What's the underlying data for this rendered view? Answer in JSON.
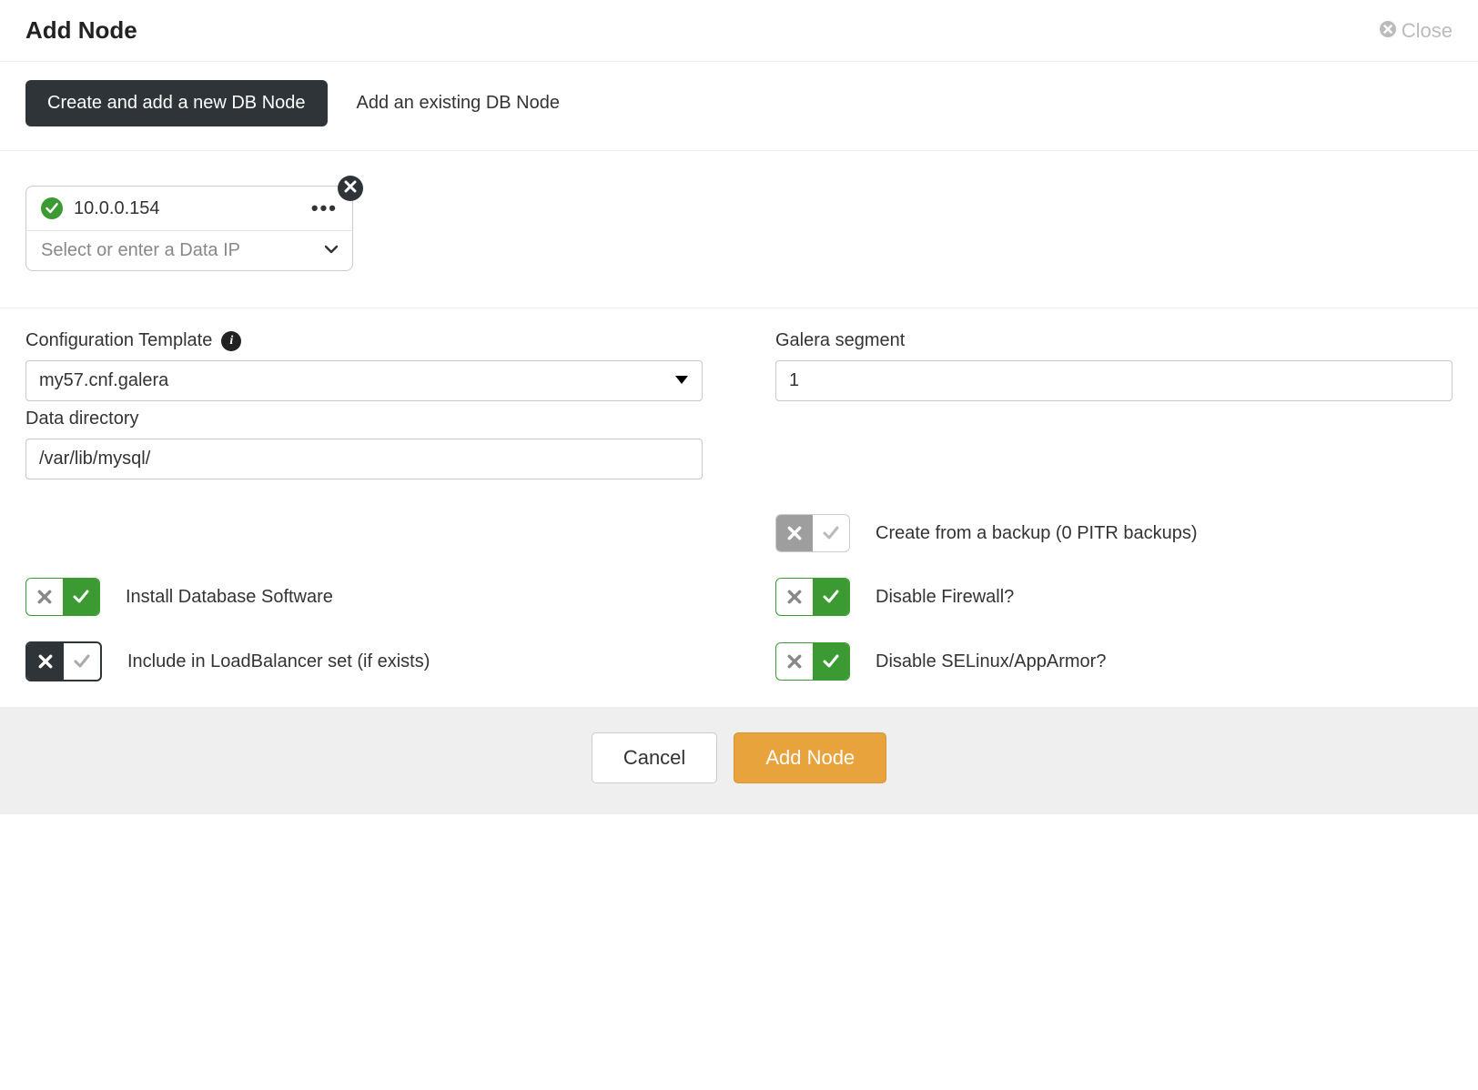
{
  "header": {
    "title": "Add Node",
    "close": "Close"
  },
  "tabs": {
    "create": "Create and add a new DB Node",
    "existing": "Add an existing DB Node"
  },
  "host": {
    "ip": "10.0.0.154",
    "data_ip_placeholder": "Select or enter a Data IP"
  },
  "form": {
    "config_template_label": "Configuration Template",
    "config_template_value": "my57.cnf.galera",
    "galera_segment_label": "Galera segment",
    "galera_segment_value": "1",
    "data_directory_label": "Data directory",
    "data_directory_value": "/var/lib/mysql/"
  },
  "toggles": {
    "create_from_backup": "Create from a backup (0 PITR backups)",
    "install_db_software": "Install Database Software",
    "disable_firewall": "Disable Firewall?",
    "include_in_lb": "Include in LoadBalancer set (if exists)",
    "disable_selinux": "Disable SELinux/AppArmor?"
  },
  "footer": {
    "cancel": "Cancel",
    "submit": "Add Node"
  }
}
